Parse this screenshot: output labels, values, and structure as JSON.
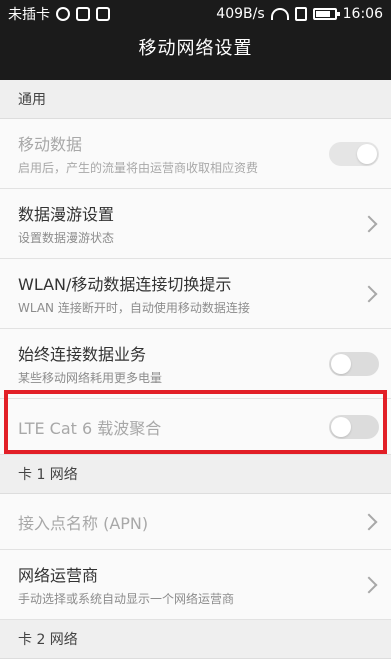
{
  "status": {
    "carrier": "未插卡",
    "speed": "409B/s",
    "time": "16:06",
    "battery_level": 0.75
  },
  "header": {
    "title": "移动网络设置"
  },
  "sections": {
    "general": "通用",
    "card1": "卡 1 网络",
    "card2": "卡 2 网络"
  },
  "rows": {
    "mobile_data": {
      "title": "移动数据",
      "subtitle": "启用后，产生的流量将由运营商收取相应资费"
    },
    "roaming": {
      "title": "数据漫游设置",
      "subtitle": "设置数据漫游状态"
    },
    "wlan_switch": {
      "title": "WLAN/移动数据连接切换提示",
      "subtitle": "WLAN 连接断开时，自动使用移动数据连接"
    },
    "always_on": {
      "title": "始终连接数据业务",
      "subtitle": "某些移动网络耗用更多电量"
    },
    "lte_ca": {
      "title": "LTE Cat 6 载波聚合"
    },
    "apn": {
      "title": "接入点名称 (APN)"
    },
    "operator": {
      "title": "网络运营商",
      "subtitle": "手动选择或系统自动显示一个网络运营商"
    }
  },
  "icons": [
    "sim-icon",
    "photo-icon",
    "edit-icon",
    "wifi-icon",
    "phone-icon",
    "battery-icon",
    "chevron-right-icon"
  ],
  "colors": {
    "highlight": "#e21f27",
    "topbar": "#1b1b1b"
  }
}
